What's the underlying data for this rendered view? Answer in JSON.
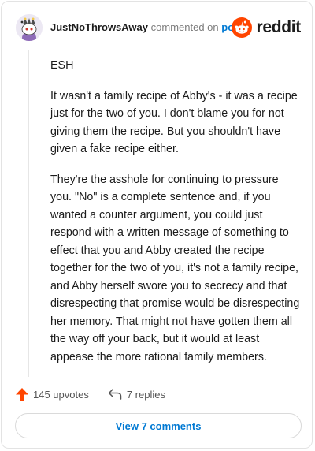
{
  "comment": {
    "username": "JustNoThrowsAway",
    "commented_on": "commented on",
    "post_link": "post",
    "paragraphs": [
      "ESH",
      "It wasn't a family recipe of Abby's - it was a recipe just for the two of you. I don't blame you for not giving them the recipe. But you shouldn't have given a fake recipe either.",
      "They're the asshole for continuing to pressure you. \"No\" is a complete sentence and, if you wanted a counter argument, you could just respond with a written message of something to effect that you and Abby created the recipe together for the two of you, it's not a family recipe, and Abby herself swore you to secrecy and that disrespecting that promise would be disrespecting her memory. That might not have gotten them all the way off your back, but it would at least appease the more rational family members."
    ]
  },
  "brand": {
    "name": "reddit",
    "icon": "reddit-logo-icon",
    "color": "#ff4500"
  },
  "actions": {
    "upvotes": "145 upvotes",
    "replies": "7 replies"
  },
  "view_comments": "View 7 comments",
  "colors": {
    "accent": "#0079d3",
    "upvote": "#ff4500"
  }
}
